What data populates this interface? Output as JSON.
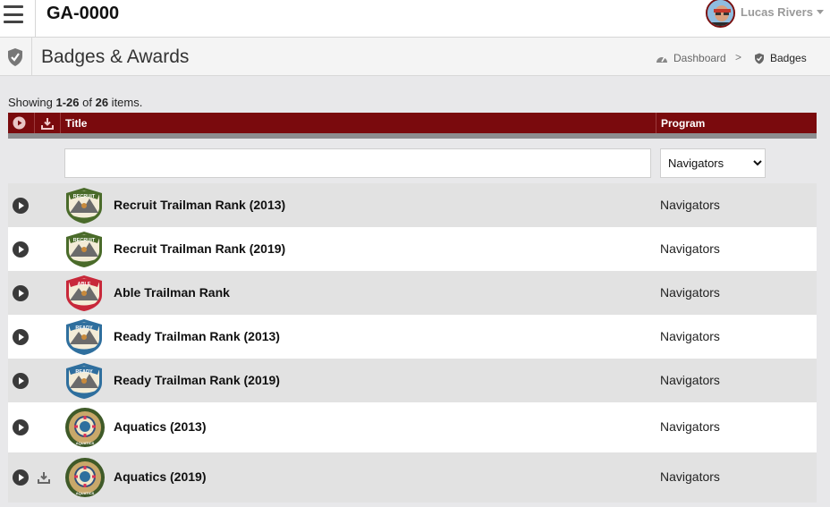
{
  "app": {
    "title": "GA-0000",
    "user": "Lucas Rivers"
  },
  "page": {
    "title": "Badges & Awards"
  },
  "breadcrumb": {
    "dashboard": "Dashboard",
    "current": "Badges",
    "separator": ">"
  },
  "summary": {
    "prefix": "Showing ",
    "range": "1-26",
    "middle": " of ",
    "total": "26",
    "suffix": " items."
  },
  "table": {
    "columns": {
      "title": "Title",
      "program": "Program"
    },
    "filter": {
      "title_value": "",
      "program_selected": "Navigators"
    },
    "rows": [
      {
        "title": "Recruit Trailman Rank (2013)",
        "program": "Navigators",
        "badge": "recruit-badge-icon",
        "download": false
      },
      {
        "title": "Recruit Trailman Rank (2019)",
        "program": "Navigators",
        "badge": "recruit-badge-icon",
        "download": false
      },
      {
        "title": "Able Trailman Rank",
        "program": "Navigators",
        "badge": "able-badge-icon",
        "download": false
      },
      {
        "title": "Ready Trailman Rank (2013)",
        "program": "Navigators",
        "badge": "ready-badge-icon",
        "download": false
      },
      {
        "title": "Ready Trailman Rank (2019)",
        "program": "Navigators",
        "badge": "ready-badge-icon",
        "download": false
      },
      {
        "title": "Aquatics (2013)",
        "program": "Navigators",
        "badge": "aquatics-badge-icon",
        "download": false
      },
      {
        "title": "Aquatics (2019)",
        "program": "Navigators",
        "badge": "aquatics-badge-icon",
        "download": true
      }
    ]
  },
  "badge_labels": {
    "recruit": "RECRUIT",
    "able": "ABLE",
    "ready": "READY",
    "aquatics": "AQUATICS"
  },
  "colors": {
    "header_bar": "#7a0a0d",
    "recruit": "#4a6b2a",
    "able": "#c8283a",
    "ready": "#2f6f9e",
    "aquatics": "#3f5a28"
  }
}
